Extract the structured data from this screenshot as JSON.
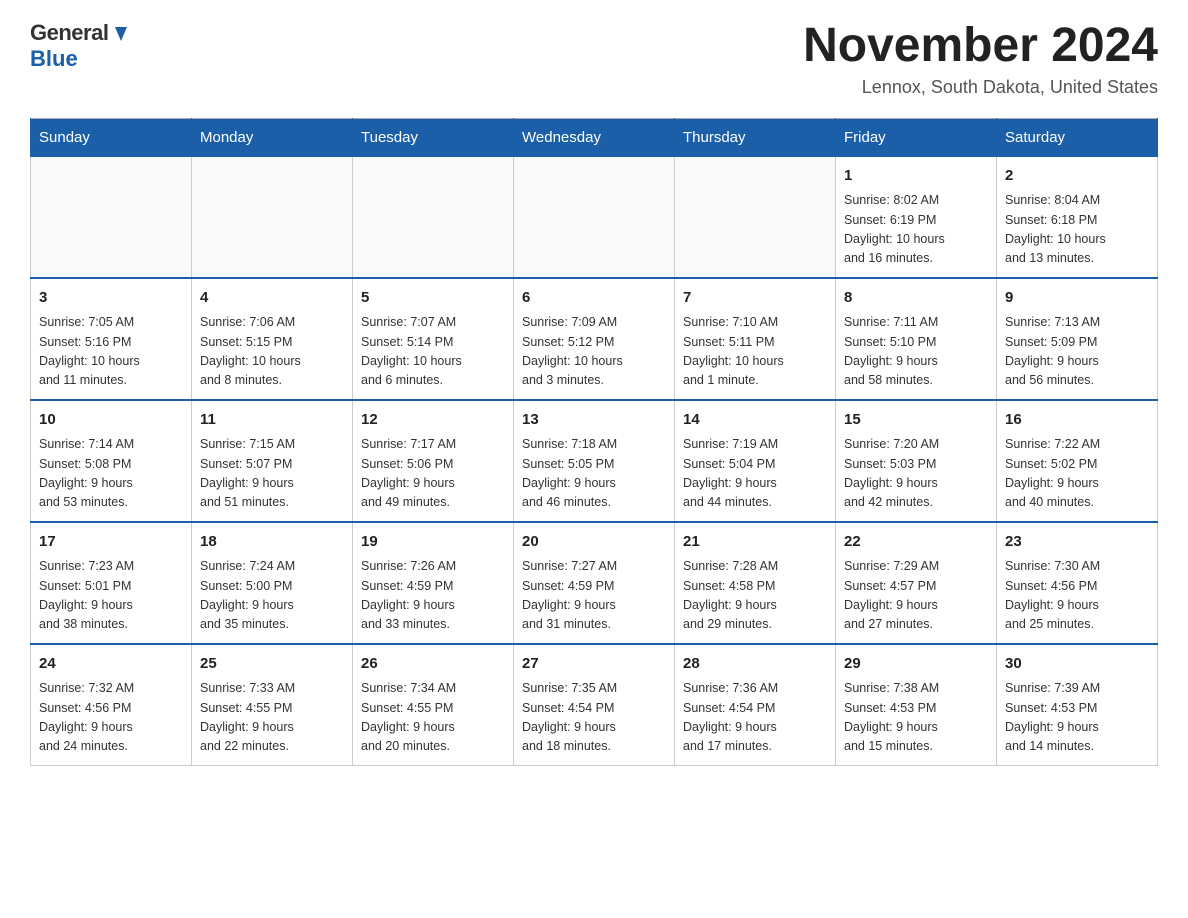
{
  "logo": {
    "general": "General",
    "blue": "Blue"
  },
  "title": "November 2024",
  "location": "Lennox, South Dakota, United States",
  "days_of_week": [
    "Sunday",
    "Monday",
    "Tuesday",
    "Wednesday",
    "Thursday",
    "Friday",
    "Saturday"
  ],
  "weeks": [
    [
      {
        "day": "",
        "info": ""
      },
      {
        "day": "",
        "info": ""
      },
      {
        "day": "",
        "info": ""
      },
      {
        "day": "",
        "info": ""
      },
      {
        "day": "",
        "info": ""
      },
      {
        "day": "1",
        "info": "Sunrise: 8:02 AM\nSunset: 6:19 PM\nDaylight: 10 hours\nand 16 minutes."
      },
      {
        "day": "2",
        "info": "Sunrise: 8:04 AM\nSunset: 6:18 PM\nDaylight: 10 hours\nand 13 minutes."
      }
    ],
    [
      {
        "day": "3",
        "info": "Sunrise: 7:05 AM\nSunset: 5:16 PM\nDaylight: 10 hours\nand 11 minutes."
      },
      {
        "day": "4",
        "info": "Sunrise: 7:06 AM\nSunset: 5:15 PM\nDaylight: 10 hours\nand 8 minutes."
      },
      {
        "day": "5",
        "info": "Sunrise: 7:07 AM\nSunset: 5:14 PM\nDaylight: 10 hours\nand 6 minutes."
      },
      {
        "day": "6",
        "info": "Sunrise: 7:09 AM\nSunset: 5:12 PM\nDaylight: 10 hours\nand 3 minutes."
      },
      {
        "day": "7",
        "info": "Sunrise: 7:10 AM\nSunset: 5:11 PM\nDaylight: 10 hours\nand 1 minute."
      },
      {
        "day": "8",
        "info": "Sunrise: 7:11 AM\nSunset: 5:10 PM\nDaylight: 9 hours\nand 58 minutes."
      },
      {
        "day": "9",
        "info": "Sunrise: 7:13 AM\nSunset: 5:09 PM\nDaylight: 9 hours\nand 56 minutes."
      }
    ],
    [
      {
        "day": "10",
        "info": "Sunrise: 7:14 AM\nSunset: 5:08 PM\nDaylight: 9 hours\nand 53 minutes."
      },
      {
        "day": "11",
        "info": "Sunrise: 7:15 AM\nSunset: 5:07 PM\nDaylight: 9 hours\nand 51 minutes."
      },
      {
        "day": "12",
        "info": "Sunrise: 7:17 AM\nSunset: 5:06 PM\nDaylight: 9 hours\nand 49 minutes."
      },
      {
        "day": "13",
        "info": "Sunrise: 7:18 AM\nSunset: 5:05 PM\nDaylight: 9 hours\nand 46 minutes."
      },
      {
        "day": "14",
        "info": "Sunrise: 7:19 AM\nSunset: 5:04 PM\nDaylight: 9 hours\nand 44 minutes."
      },
      {
        "day": "15",
        "info": "Sunrise: 7:20 AM\nSunset: 5:03 PM\nDaylight: 9 hours\nand 42 minutes."
      },
      {
        "day": "16",
        "info": "Sunrise: 7:22 AM\nSunset: 5:02 PM\nDaylight: 9 hours\nand 40 minutes."
      }
    ],
    [
      {
        "day": "17",
        "info": "Sunrise: 7:23 AM\nSunset: 5:01 PM\nDaylight: 9 hours\nand 38 minutes."
      },
      {
        "day": "18",
        "info": "Sunrise: 7:24 AM\nSunset: 5:00 PM\nDaylight: 9 hours\nand 35 minutes."
      },
      {
        "day": "19",
        "info": "Sunrise: 7:26 AM\nSunset: 4:59 PM\nDaylight: 9 hours\nand 33 minutes."
      },
      {
        "day": "20",
        "info": "Sunrise: 7:27 AM\nSunset: 4:59 PM\nDaylight: 9 hours\nand 31 minutes."
      },
      {
        "day": "21",
        "info": "Sunrise: 7:28 AM\nSunset: 4:58 PM\nDaylight: 9 hours\nand 29 minutes."
      },
      {
        "day": "22",
        "info": "Sunrise: 7:29 AM\nSunset: 4:57 PM\nDaylight: 9 hours\nand 27 minutes."
      },
      {
        "day": "23",
        "info": "Sunrise: 7:30 AM\nSunset: 4:56 PM\nDaylight: 9 hours\nand 25 minutes."
      }
    ],
    [
      {
        "day": "24",
        "info": "Sunrise: 7:32 AM\nSunset: 4:56 PM\nDaylight: 9 hours\nand 24 minutes."
      },
      {
        "day": "25",
        "info": "Sunrise: 7:33 AM\nSunset: 4:55 PM\nDaylight: 9 hours\nand 22 minutes."
      },
      {
        "day": "26",
        "info": "Sunrise: 7:34 AM\nSunset: 4:55 PM\nDaylight: 9 hours\nand 20 minutes."
      },
      {
        "day": "27",
        "info": "Sunrise: 7:35 AM\nSunset: 4:54 PM\nDaylight: 9 hours\nand 18 minutes."
      },
      {
        "day": "28",
        "info": "Sunrise: 7:36 AM\nSunset: 4:54 PM\nDaylight: 9 hours\nand 17 minutes."
      },
      {
        "day": "29",
        "info": "Sunrise: 7:38 AM\nSunset: 4:53 PM\nDaylight: 9 hours\nand 15 minutes."
      },
      {
        "day": "30",
        "info": "Sunrise: 7:39 AM\nSunset: 4:53 PM\nDaylight: 9 hours\nand 14 minutes."
      }
    ]
  ]
}
